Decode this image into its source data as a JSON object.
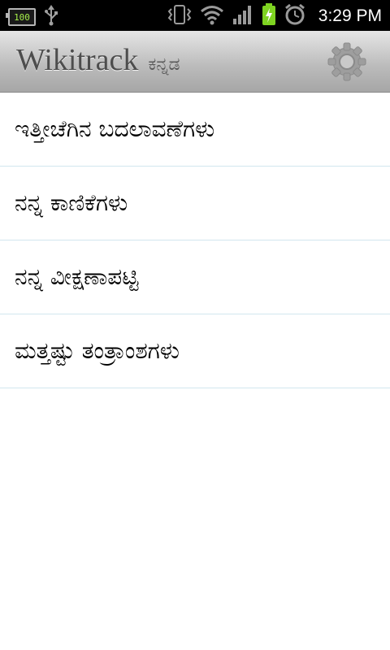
{
  "status_bar": {
    "battery_level_text": "100",
    "time": "3:29 PM",
    "icons": [
      "battery-icon",
      "usb-icon",
      "vibrate-icon",
      "wifi-icon",
      "signal-icon",
      "charging-battery-icon",
      "alarm-icon"
    ]
  },
  "header": {
    "title": "Wikitrack",
    "language": "ಕನ್ನಡ",
    "settings_icon": "gear-icon"
  },
  "menu": {
    "items": [
      {
        "label": "ಇತ್ತೀಚೆಗಿನ ಬದಲಾವಣೆಗಳು"
      },
      {
        "label": "ನನ್ನ ಕಾಣಿಕೆಗಳು"
      },
      {
        "label": "ನನ್ನ ವೀಕ್ಷಣಾಪಟ್ಟಿ"
      },
      {
        "label": "ಮತ್ತಷ್ಟು ತಂತ್ರಾಂಶಗಳು"
      }
    ]
  },
  "colors": {
    "status_bar_bg": "#000000",
    "header_gradient_top": "#e6e6e6",
    "header_gradient_bottom": "#a6a6a6",
    "divider": "#d2e6ee",
    "text": "#000000"
  }
}
